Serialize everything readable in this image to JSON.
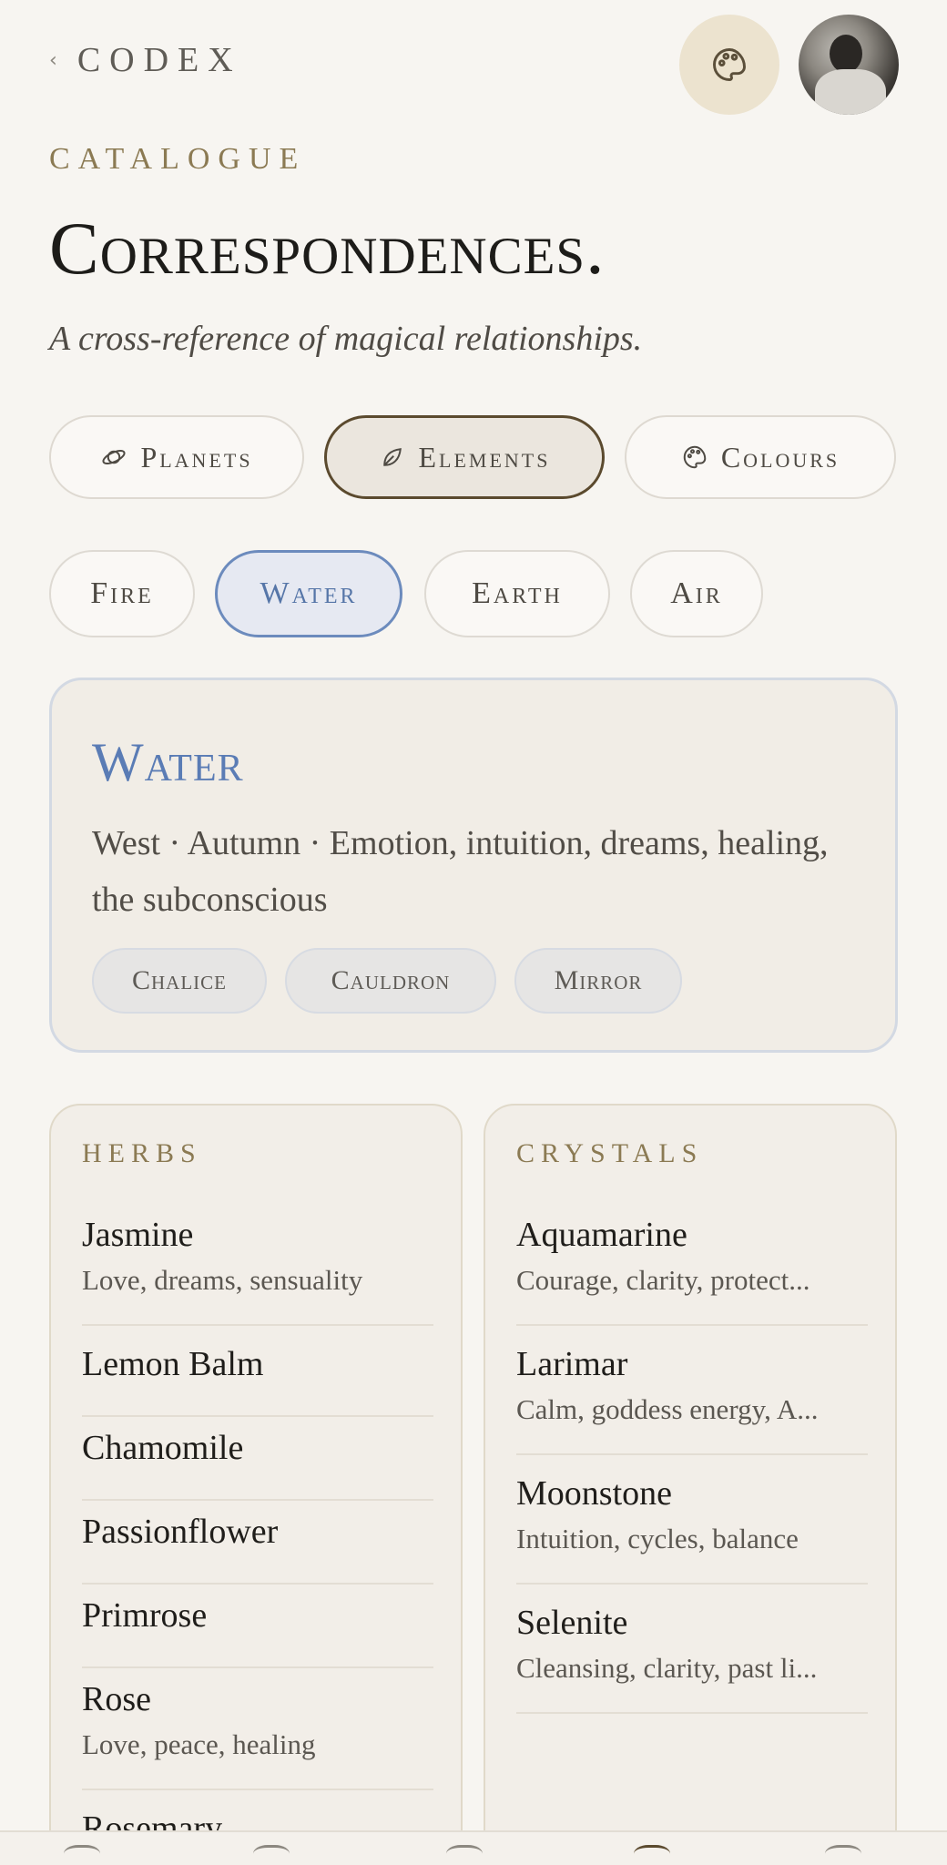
{
  "header": {
    "back_label": "CODEX",
    "palette_icon": "palette-icon",
    "avatar_alt": "avatar"
  },
  "page": {
    "eyebrow": "CATALOGUE",
    "title": "Correspondences.",
    "subtitle": "A cross-reference of magical relationships."
  },
  "categories": [
    {
      "label": "Planets",
      "icon": "planet-icon",
      "active": false
    },
    {
      "label": "Elements",
      "icon": "leaf-icon",
      "active": true
    },
    {
      "label": "Colours",
      "icon": "palette-icon",
      "active": false
    }
  ],
  "elements": [
    {
      "label": "Fire",
      "active": false
    },
    {
      "label": "Water",
      "active": true
    },
    {
      "label": "Earth",
      "active": false
    },
    {
      "label": "Air",
      "active": false
    }
  ],
  "detail": {
    "name": "Water",
    "description": "West · Autumn · Emotion, intuition, dreams, healing, the subconscious",
    "tags": [
      "Chalice",
      "Cauldron",
      "Mirror"
    ],
    "accent": "#5a7cb5"
  },
  "herbs": {
    "heading": "HERBS",
    "items": [
      {
        "name": "Jasmine",
        "desc": "Love, dreams, sensuality"
      },
      {
        "name": "Lemon Balm",
        "desc": ""
      },
      {
        "name": "Chamomile",
        "desc": ""
      },
      {
        "name": "Passionflower",
        "desc": ""
      },
      {
        "name": "Primrose",
        "desc": ""
      },
      {
        "name": "Rose",
        "desc": "Love, peace, healing"
      },
      {
        "name": "Rosemary",
        "desc": ""
      }
    ]
  },
  "crystals": {
    "heading": "CRYSTALS",
    "items": [
      {
        "name": "Aquamarine",
        "desc": "Courage, clarity, protect..."
      },
      {
        "name": "Larimar",
        "desc": "Calm, goddess energy, A..."
      },
      {
        "name": "Moonstone",
        "desc": "Intuition, cycles, balance"
      },
      {
        "name": "Selenite",
        "desc": "Cleansing, clarity, past li..."
      }
    ]
  }
}
